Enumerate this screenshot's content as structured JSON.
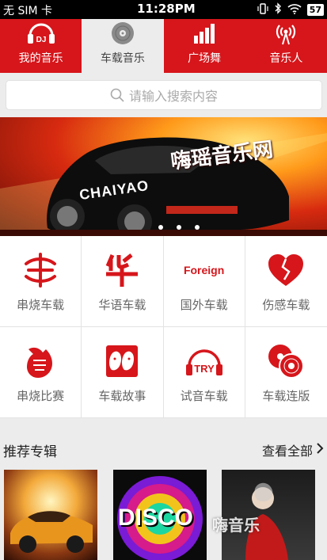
{
  "status_bar": {
    "carrier": "无 SIM 卡",
    "time": "11:28PM",
    "battery": "57"
  },
  "tabs": [
    {
      "label": "我的音乐",
      "icon": "headphones-dj-icon",
      "active": false
    },
    {
      "label": "车载音乐",
      "icon": "disc-icon",
      "active": true
    },
    {
      "label": "广场舞",
      "icon": "bar-chart-icon",
      "active": false
    },
    {
      "label": "音乐人",
      "icon": "broadcast-icon",
      "active": false
    }
  ],
  "search": {
    "placeholder": "请输入搜索内容"
  },
  "banner": {
    "title": "嗨瑶音乐网",
    "brand": "CHAIYAO",
    "dots": 3
  },
  "categories": [
    {
      "label": "串烧车载",
      "icon": "symbol-icon"
    },
    {
      "label": "华语车载",
      "icon": "hua-character-icon"
    },
    {
      "label": "国外车载",
      "icon": "foreign-text-icon",
      "icon_text": "Foreign"
    },
    {
      "label": "伤感车载",
      "icon": "broken-heart-icon"
    },
    {
      "label": "串烧比赛",
      "icon": "handshake-icon"
    },
    {
      "label": "车载故事",
      "icon": "faces-icon"
    },
    {
      "label": "试音车载",
      "icon": "try-headphones-icon",
      "icon_text": "TRY"
    },
    {
      "label": "车载连版",
      "icon": "discs-icon"
    }
  ],
  "section": {
    "title": "推荐专辑",
    "more": "查看全部"
  },
  "albums": [
    {
      "name": "car-album"
    },
    {
      "name": "disco-album",
      "text": "DISCO"
    },
    {
      "name": "singer-album"
    }
  ],
  "watermark": "嗨音乐",
  "colors": {
    "brand_red": "#d6161b",
    "background": "#ececec"
  }
}
